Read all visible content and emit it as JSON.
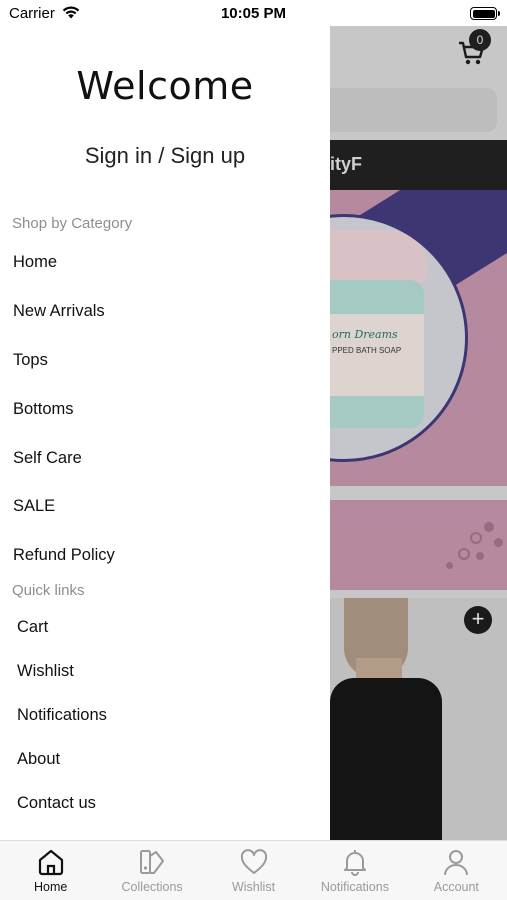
{
  "status_bar": {
    "carrier": "Carrier",
    "time": "10:05 PM"
  },
  "drawer": {
    "welcome": "Welcome",
    "signin": "Sign in / Sign up",
    "shop_label": "Shop by Category",
    "categories": [
      "Home",
      "New Arrivals",
      "Tops",
      "Bottoms",
      "Self Care",
      "SALE",
      "Refund Policy"
    ],
    "quick_label": "Quick links",
    "quick_links": [
      "Cart",
      "Wishlist",
      "Notifications",
      "About",
      "Contact us"
    ]
  },
  "background": {
    "cart_count": "0",
    "banner_text": "ityF",
    "product_text_1": "orn Dreams",
    "product_text_2": "PPED BATH SOAP",
    "add_symbol": "+"
  },
  "tab_bar": {
    "tabs": [
      {
        "label": "Home",
        "icon": "home-icon",
        "active": true
      },
      {
        "label": "Collections",
        "icon": "collections-icon",
        "active": false
      },
      {
        "label": "Wishlist",
        "icon": "heart-icon",
        "active": false
      },
      {
        "label": "Notifications",
        "icon": "bell-icon",
        "active": false
      },
      {
        "label": "Account",
        "icon": "person-icon",
        "active": false
      }
    ]
  },
  "colors": {
    "accent": "#111111",
    "inactive": "#9a9a9a",
    "section_label": "#8e8e8e",
    "overlay_bg": "#c7c7c7"
  }
}
